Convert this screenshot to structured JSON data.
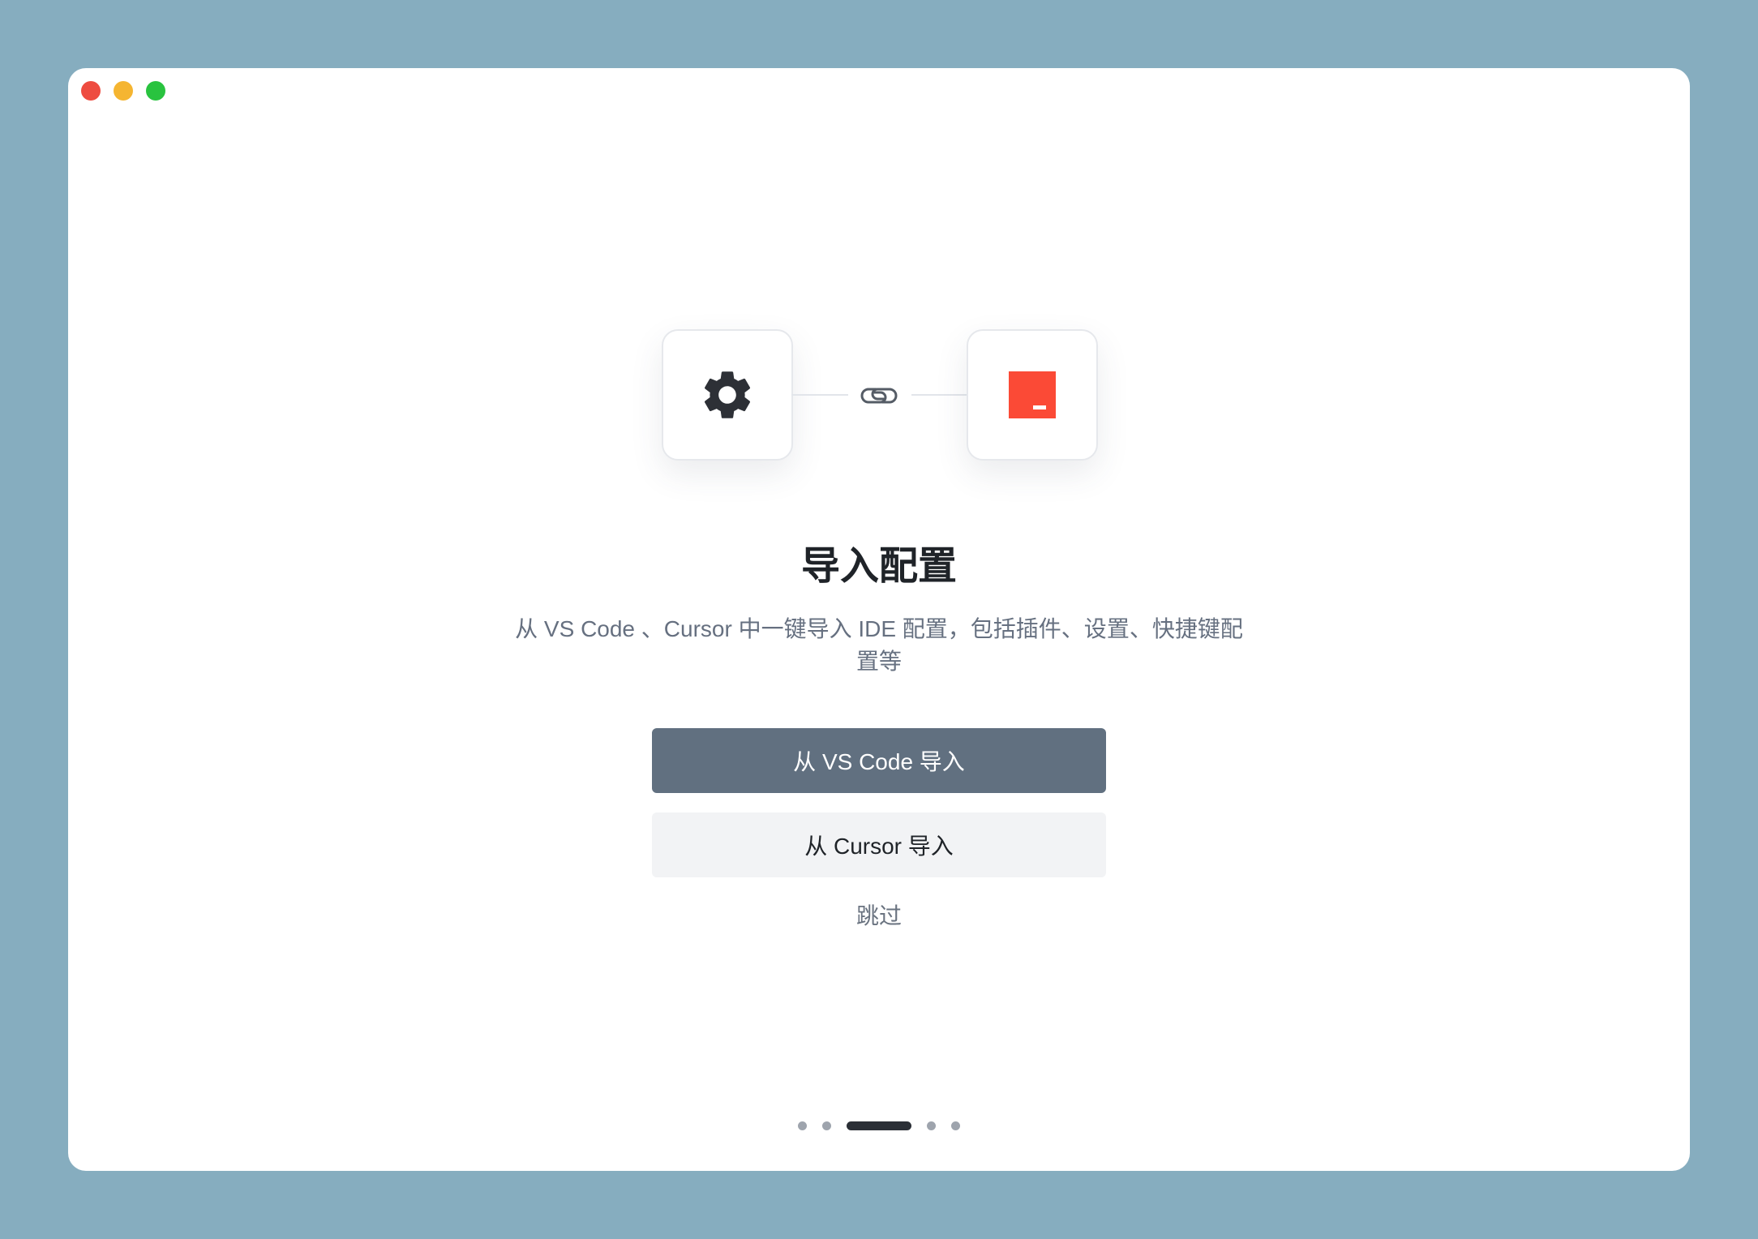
{
  "window": {
    "controls": [
      "close",
      "minimize",
      "zoom"
    ]
  },
  "hero": {
    "left_icon": "gear-icon",
    "middle_icon": "link-icon",
    "right_icon": "brand-logo"
  },
  "content": {
    "title": "导入配置",
    "description": "从 VS Code 、Cursor 中一键导入 IDE 配置，包括插件、设置、快捷键配置等"
  },
  "actions": {
    "import_vscode": "从 VS Code 导入",
    "import_cursor": "从 Cursor 导入",
    "skip": "跳过"
  },
  "pagination": {
    "total": 5,
    "current": 3
  },
  "colors": {
    "background": "#86adbf",
    "primary_button": "#617080",
    "brand": "#fb4a36",
    "close": "#ee4c40",
    "minimize": "#f5b531",
    "zoom": "#29c33f"
  }
}
